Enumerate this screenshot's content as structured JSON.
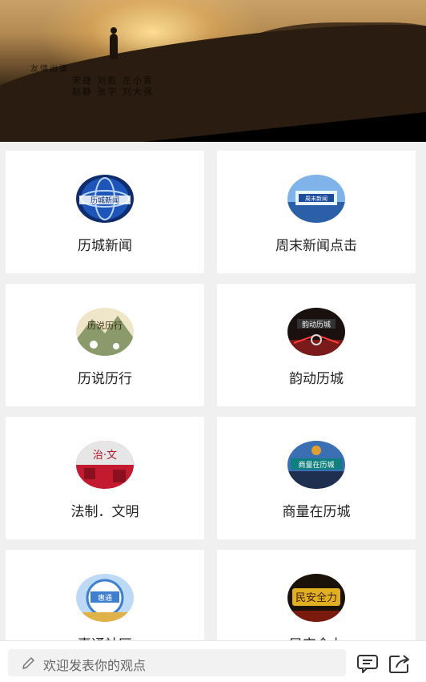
{
  "video": {
    "credits_line1": "友情出演",
    "credits_line2": "宋捷  刘胜  左小青",
    "credits_line3": "赵静  张宇  刘大强"
  },
  "channels": [
    {
      "label": "历城新闻",
      "icon": "news-globe-icon",
      "color": "#1b3f8f"
    },
    {
      "label": "周末新闻点击",
      "icon": "studio-screen-icon",
      "color": "#2a6fc8"
    },
    {
      "label": "历说历行",
      "icon": "mountain-painting-icon",
      "color": "#c9b98a"
    },
    {
      "label": "韵动历城",
      "icon": "red-stage-icon",
      "color": "#5a1b1b"
    },
    {
      "label": "法制．文明",
      "icon": "law-civility-icon",
      "color": "#b3122b"
    },
    {
      "label": "商量在历城",
      "icon": "discussion-panel-icon",
      "color": "#2b4f8a"
    },
    {
      "label": "惠通社区",
      "icon": "community-icon",
      "color": "#3e7fd0"
    },
    {
      "label": "民安全力",
      "icon": "safety-gold-icon",
      "color": "#d3a21a"
    }
  ],
  "comment": {
    "placeholder": "欢迎发表你的观点"
  }
}
